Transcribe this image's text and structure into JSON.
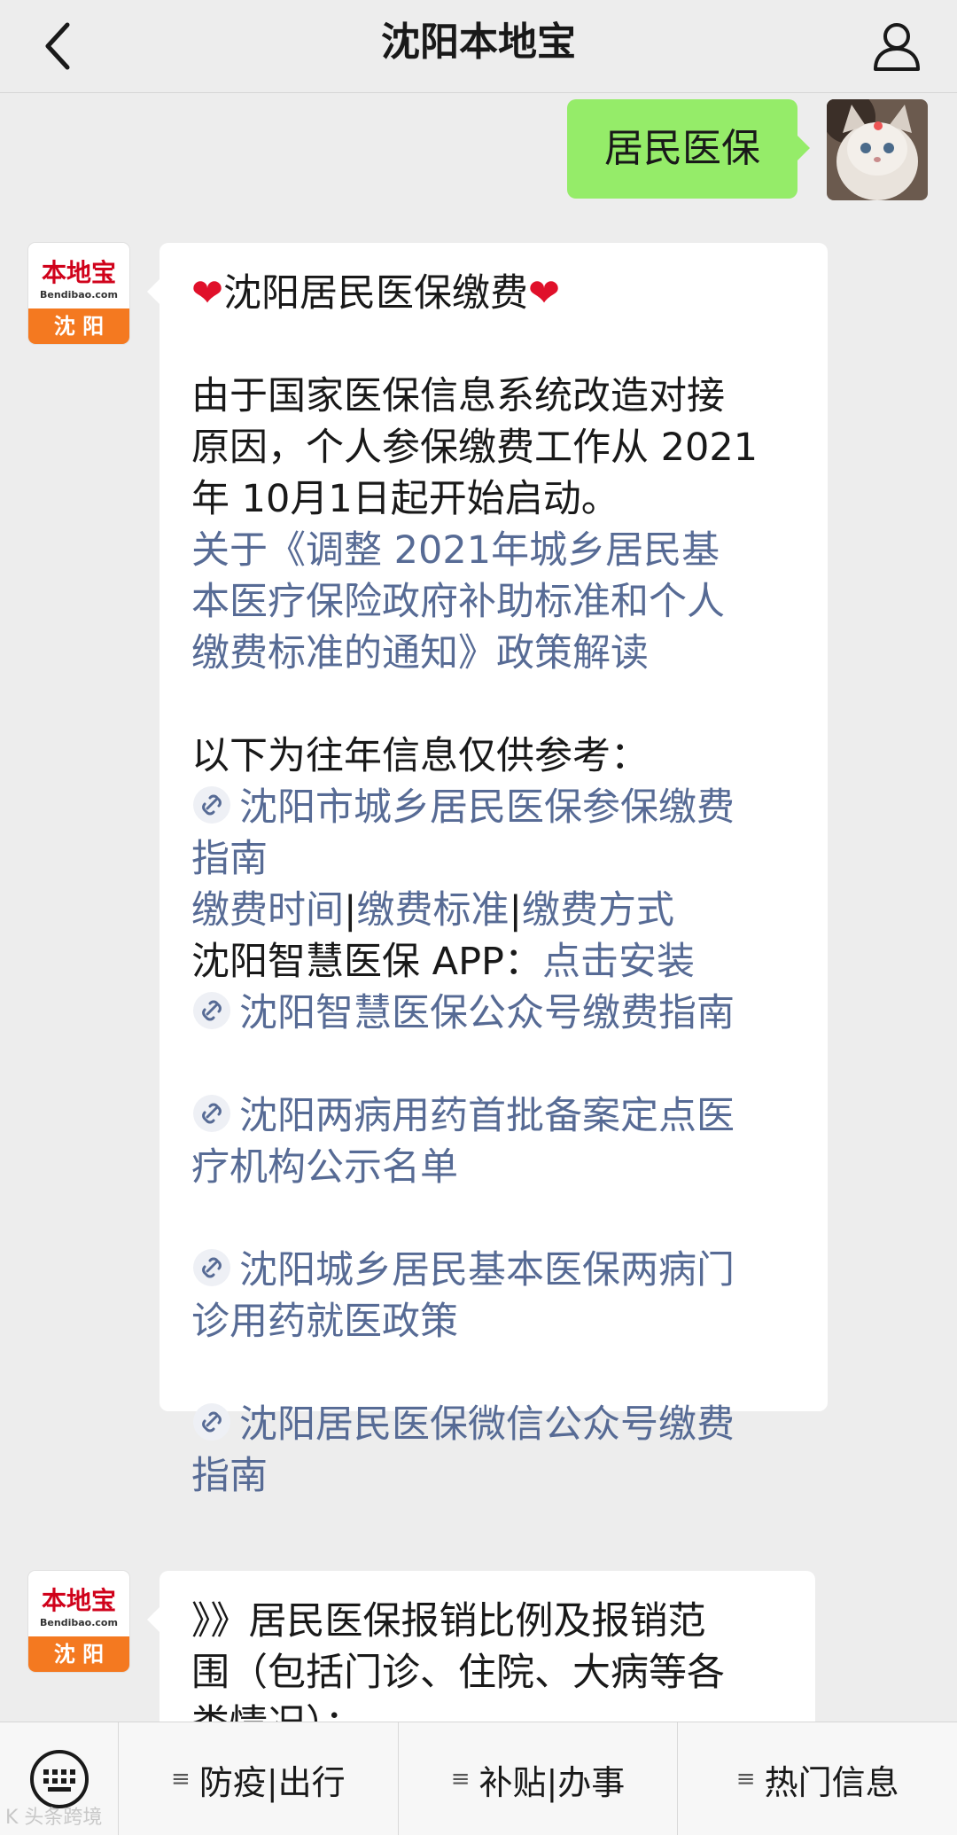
{
  "header": {
    "title": "沈阳本地宝"
  },
  "user_message": {
    "text": "居民医保"
  },
  "bot_avatar": {
    "brand": "本地宝",
    "domain": "Bendibao.com",
    "city": "沈 阳"
  },
  "message1": {
    "heading": "沈阳居民医保缴费",
    "heart": "❤",
    "para1_lines": [
      "由于国家医保信息系统改造对接",
      "原因，个人参保缴费工作从 2021",
      "年 10月1日起开始启动。"
    ],
    "policy_link_lines": [
      "关于《调整 2021年城乡居民基",
      "本医疗保险政府补助标准和个人",
      "缴费标准的通知》政策解读"
    ],
    "ref_intro": "以下为往年信息仅供参考：",
    "guide_link_lines": [
      "沈阳市城乡居民医保参保缴费",
      "指南"
    ],
    "quick_links": [
      "缴费时间",
      "缴费标准",
      "缴费方式"
    ],
    "separator": "|",
    "app_label": "沈阳智慧医保 APP：",
    "app_link": "点击安装",
    "wechat_guide_link": "沈阳智慧医保公众号缴费指南",
    "two_disease_link_lines": [
      "沈阳两病用药首批备案定点医",
      "疗机构公示名单"
    ],
    "outpatient_link_lines": [
      "沈阳城乡居民基本医保两病门",
      "诊用药就医政策"
    ],
    "resident_wechat_link_lines": [
      "沈阳居民医保微信公众号缴费",
      "指南"
    ]
  },
  "message2": {
    "lines": [
      "》》居民医保报销比例及报销范",
      "围（包括门诊、住院、大病等各",
      "类情况）："
    ]
  },
  "bottom_menu": {
    "items": [
      "防疫|出行",
      "补贴|办事",
      "热门信息"
    ]
  },
  "watermark": "K 头条跨境",
  "colors": {
    "link": "#576b95",
    "user_bubble": "#95ec69",
    "background": "#ededed",
    "brand_orange": "#f47920"
  }
}
